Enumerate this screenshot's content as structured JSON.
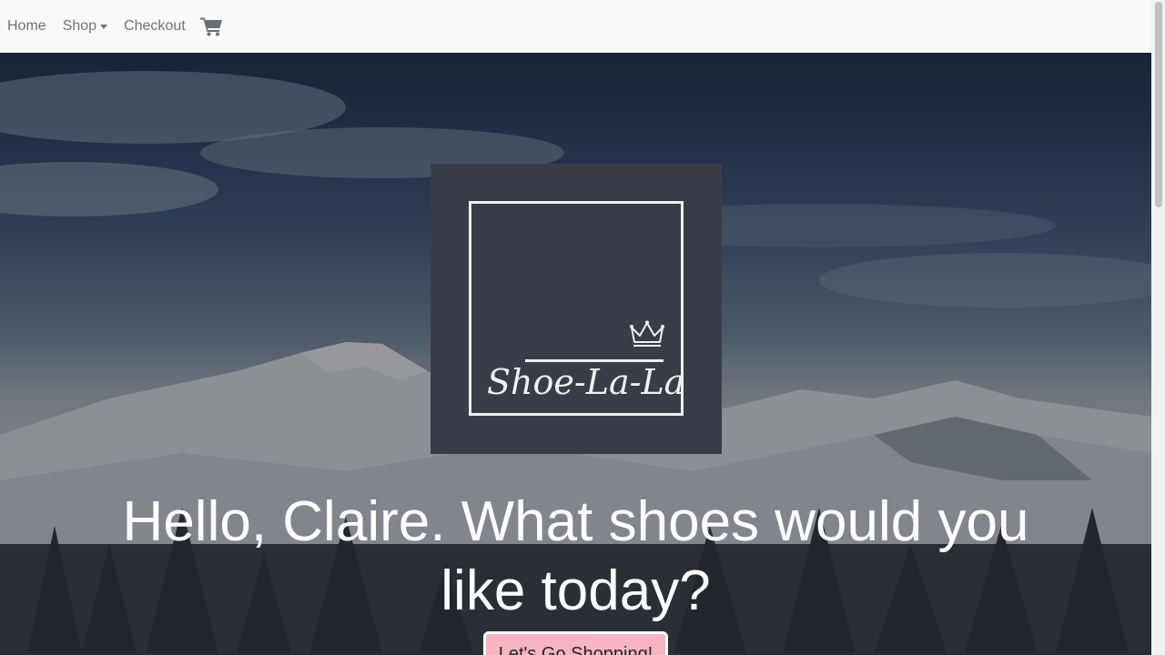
{
  "nav": {
    "home": "Home",
    "shop": "Shop",
    "checkout": "Checkout",
    "cart_icon": "shopping-cart-icon"
  },
  "hero": {
    "logo_text": "Shoe-La-La",
    "logo_icon": "crown-icon",
    "headline": "Hello, Claire. What shoes would you like today?",
    "cta_label": "Let's Go Shopping!"
  },
  "colors": {
    "navbar_bg": "#f8f9fa",
    "logo_bg": "#3a3d47",
    "cta_bg": "#f8b4c0"
  }
}
